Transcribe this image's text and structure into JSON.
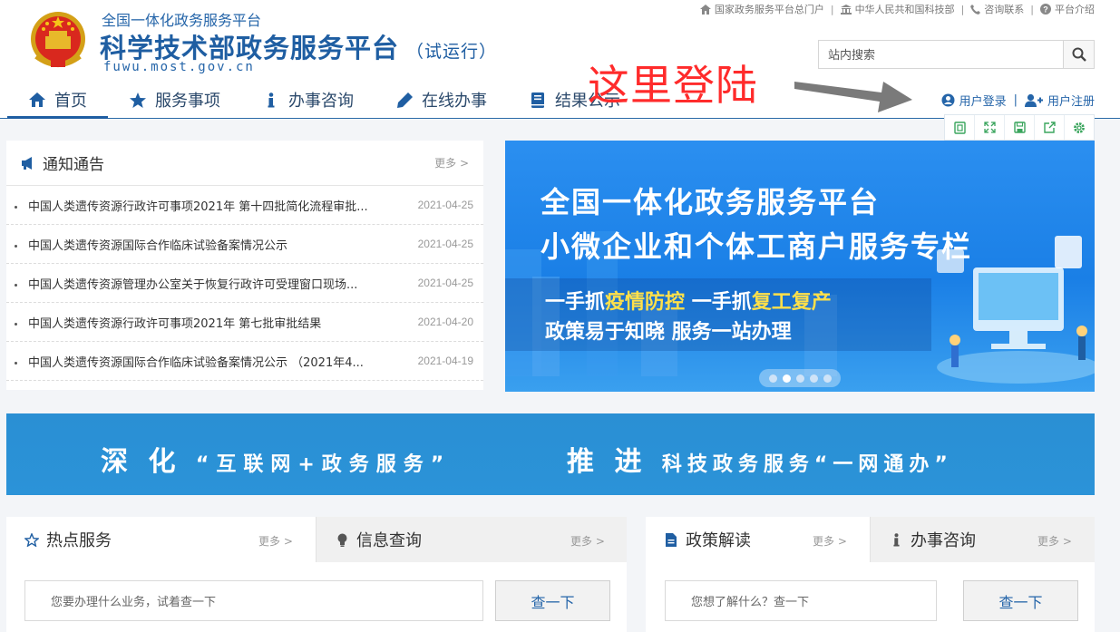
{
  "header": {
    "brand_sub": "全国一体化政务服务平台",
    "brand_main": "科学技术部政务服务平台",
    "brand_trial": "（试运行）",
    "brand_domain": "fuwu.most.gov.cn",
    "toplinks": [
      {
        "label": "国家政务服务平台总门户",
        "icon": "home-icon"
      },
      {
        "label": "中华人民共和国科技部",
        "icon": "bank-icon"
      },
      {
        "label": "咨询联系",
        "icon": "phone-icon"
      },
      {
        "label": "平台介绍",
        "icon": "question-circle-icon"
      }
    ],
    "search_placeholder": "站内搜索",
    "nav": [
      {
        "label": "首页",
        "icon": "home-icon",
        "active": true
      },
      {
        "label": "服务事项",
        "icon": "star-icon",
        "active": false
      },
      {
        "label": "办事咨询",
        "icon": "info-icon",
        "active": false
      },
      {
        "label": "在线办事",
        "icon": "pencil-icon",
        "active": false
      },
      {
        "label": "结果公示",
        "icon": "book-icon",
        "active": false
      }
    ],
    "annotation": "这里登陆",
    "user_login": "用户登录",
    "user_register": "用户注册",
    "toolbar_icons": [
      "reader-icon",
      "fullscreen-icon",
      "save-icon",
      "share-icon",
      "settings-icon"
    ]
  },
  "notice": {
    "title": "通知通告",
    "more": "更多 >",
    "items": [
      {
        "text": "中国人类遗传资源行政许可事项2021年 第十四批简化流程审批...",
        "date": "2021-04-25"
      },
      {
        "text": "中国人类遗传资源国际合作临床试验备案情况公示",
        "date": "2021-04-25"
      },
      {
        "text": "中国人类遗传资源管理办公室关于恢复行政许可受理窗口现场...",
        "date": "2021-04-25"
      },
      {
        "text": "中国人类遗传资源行政许可事项2021年 第七批审批结果",
        "date": "2021-04-20"
      },
      {
        "text": "中国人类遗传资源国际合作临床试验备案情况公示 （2021年4...",
        "date": "2021-04-19"
      }
    ]
  },
  "banner": {
    "line1": "全国一体化政务服务平台",
    "line2": "小微企业和个体工商户服务专栏",
    "line3_a": "一手抓",
    "line3_b": "疫情防控",
    "line3_c": " 一手抓",
    "line3_d": "复工复产",
    "line4": "政策易于知晓 服务一站办理",
    "slides": 5,
    "active_slide": 2
  },
  "slogan": {
    "part1_big": "深 化",
    "part1_small": "“互联网+政务服务”",
    "part2_big": "推 进",
    "part2_small": "科技政务服务“一网通办”"
  },
  "hot": {
    "tab1": "热点服务",
    "tab1_more": "更多 >",
    "tab2": "信息查询",
    "tab2_more": "更多 >",
    "placeholder": "您要办理什么业务，试着查一下",
    "button": "查一下"
  },
  "policy": {
    "tab1": "政策解读",
    "tab1_more": "更多 >",
    "tab2": "办事咨询",
    "tab2_more": "更多 >",
    "placeholder": "您想了解什么？查一下",
    "button": "查一下"
  },
  "colors": {
    "brand_blue": "#1f5ea2",
    "annotation_red": "#ff2b2b",
    "banner_blue": "#1a7fe6",
    "slogan_blue": "#2a8fd4"
  }
}
